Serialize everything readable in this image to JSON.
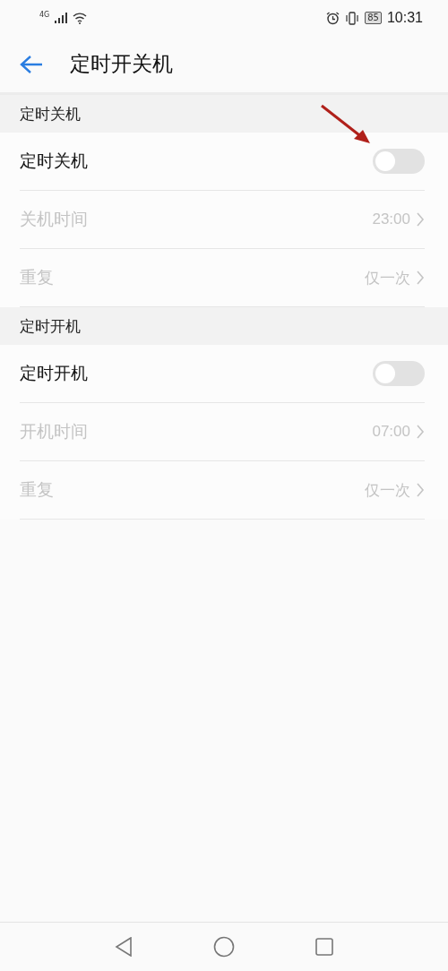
{
  "status_bar": {
    "network": "4G",
    "battery": "85",
    "time": "10:31"
  },
  "header": {
    "title": "定时开关机"
  },
  "sections": [
    {
      "title": "定时关机",
      "rows": [
        {
          "kind": "switch",
          "label": "定时关机",
          "on": false
        },
        {
          "kind": "value",
          "label": "关机时间",
          "value": "23:00",
          "disabled": true
        },
        {
          "kind": "value",
          "label": "重复",
          "value": "仅一次",
          "disabled": true
        }
      ]
    },
    {
      "title": "定时开机",
      "rows": [
        {
          "kind": "switch",
          "label": "定时开机",
          "on": false
        },
        {
          "kind": "value",
          "label": "开机时间",
          "value": "07:00",
          "disabled": true
        },
        {
          "kind": "value",
          "label": "重复",
          "value": "仅一次",
          "disabled": true
        }
      ]
    }
  ],
  "annotations": [
    {
      "kind": "arrow"
    }
  ]
}
